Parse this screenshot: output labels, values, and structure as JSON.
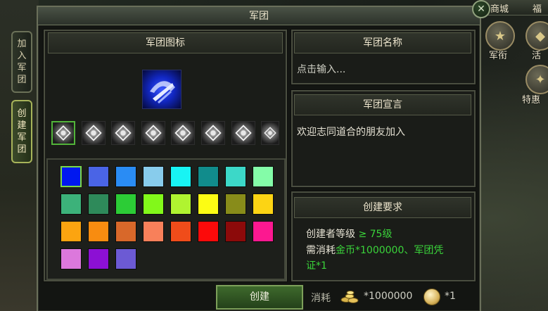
{
  "window": {
    "title": "军团"
  },
  "hud": {
    "shop_label": "商城",
    "welfare_label": "福",
    "rank_label": "军衔",
    "activity_label": "活",
    "special_label": "特惠"
  },
  "side_tabs": [
    {
      "label": "加入军团",
      "chars": [
        "加",
        "入",
        "军",
        "团"
      ]
    },
    {
      "label": "创建军团",
      "chars": [
        "创",
        "建",
        "军",
        "团"
      ]
    }
  ],
  "emblem_panel": {
    "header": "军团图标"
  },
  "emblems": [
    "emblem-1",
    "emblem-2",
    "emblem-3",
    "emblem-4",
    "emblem-5",
    "emblem-6",
    "emblem-7",
    "emblem-8"
  ],
  "colors": [
    "#0018f0",
    "#4a64e6",
    "#2a8cf4",
    "#88ccec",
    "#18f4f4",
    "#118c8c",
    "#3cd8c8",
    "#84fca8",
    "#3cb27a",
    "#2e8a5a",
    "#2ccc36",
    "#82f81a",
    "#b0f430",
    "#fcfc14",
    "#888c1a",
    "#fcd414",
    "#fca410",
    "#f88c10",
    "#d8682a",
    "#f8805a",
    "#f04c1a",
    "#fc0a0a",
    "#8c0a0a",
    "#fc1890",
    "#dc78dc",
    "#8c10d4",
    "#6c5ad4"
  ],
  "name_panel": {
    "header": "军团名称",
    "placeholder": "点击输入..."
  },
  "declaration_panel": {
    "header": "军团宣言",
    "text": "欢迎志同道合的朋友加入"
  },
  "requirements_panel": {
    "header": "创建要求",
    "level_prefix": "创建者等级 ",
    "level_value": "≥ 75级",
    "cost_prefix": "需消耗",
    "cost_value_1": "金币*1000000、军团凭",
    "cost_value_2": "证*1"
  },
  "footer": {
    "create_label": "创建",
    "cost_label": "消耗",
    "gold_amount": "*1000000",
    "cert_amount": "*1"
  }
}
